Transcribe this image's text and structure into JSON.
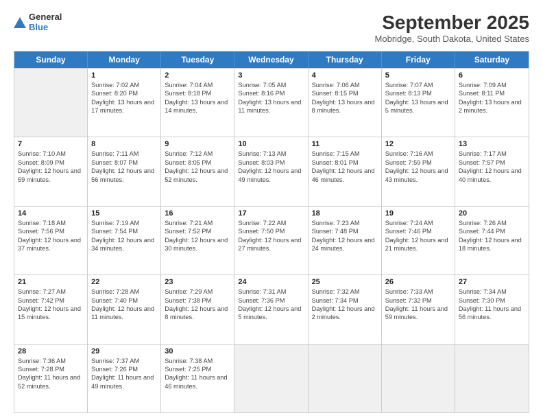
{
  "logo": {
    "general": "General",
    "blue": "Blue"
  },
  "title": "September 2025",
  "subtitle": "Mobridge, South Dakota, United States",
  "days": [
    "Sunday",
    "Monday",
    "Tuesday",
    "Wednesday",
    "Thursday",
    "Friday",
    "Saturday"
  ],
  "weeks": [
    [
      {
        "day": "",
        "sunrise": "",
        "sunset": "",
        "daylight": "",
        "shaded": true
      },
      {
        "day": "1",
        "sunrise": "Sunrise: 7:02 AM",
        "sunset": "Sunset: 8:20 PM",
        "daylight": "Daylight: 13 hours and 17 minutes."
      },
      {
        "day": "2",
        "sunrise": "Sunrise: 7:04 AM",
        "sunset": "Sunset: 8:18 PM",
        "daylight": "Daylight: 13 hours and 14 minutes."
      },
      {
        "day": "3",
        "sunrise": "Sunrise: 7:05 AM",
        "sunset": "Sunset: 8:16 PM",
        "daylight": "Daylight: 13 hours and 11 minutes."
      },
      {
        "day": "4",
        "sunrise": "Sunrise: 7:06 AM",
        "sunset": "Sunset: 8:15 PM",
        "daylight": "Daylight: 13 hours and 8 minutes."
      },
      {
        "day": "5",
        "sunrise": "Sunrise: 7:07 AM",
        "sunset": "Sunset: 8:13 PM",
        "daylight": "Daylight: 13 hours and 5 minutes."
      },
      {
        "day": "6",
        "sunrise": "Sunrise: 7:09 AM",
        "sunset": "Sunset: 8:11 PM",
        "daylight": "Daylight: 13 hours and 2 minutes."
      }
    ],
    [
      {
        "day": "7",
        "sunrise": "Sunrise: 7:10 AM",
        "sunset": "Sunset: 8:09 PM",
        "daylight": "Daylight: 12 hours and 59 minutes."
      },
      {
        "day": "8",
        "sunrise": "Sunrise: 7:11 AM",
        "sunset": "Sunset: 8:07 PM",
        "daylight": "Daylight: 12 hours and 56 minutes."
      },
      {
        "day": "9",
        "sunrise": "Sunrise: 7:12 AM",
        "sunset": "Sunset: 8:05 PM",
        "daylight": "Daylight: 12 hours and 52 minutes."
      },
      {
        "day": "10",
        "sunrise": "Sunrise: 7:13 AM",
        "sunset": "Sunset: 8:03 PM",
        "daylight": "Daylight: 12 hours and 49 minutes."
      },
      {
        "day": "11",
        "sunrise": "Sunrise: 7:15 AM",
        "sunset": "Sunset: 8:01 PM",
        "daylight": "Daylight: 12 hours and 46 minutes."
      },
      {
        "day": "12",
        "sunrise": "Sunrise: 7:16 AM",
        "sunset": "Sunset: 7:59 PM",
        "daylight": "Daylight: 12 hours and 43 minutes."
      },
      {
        "day": "13",
        "sunrise": "Sunrise: 7:17 AM",
        "sunset": "Sunset: 7:57 PM",
        "daylight": "Daylight: 12 hours and 40 minutes."
      }
    ],
    [
      {
        "day": "14",
        "sunrise": "Sunrise: 7:18 AM",
        "sunset": "Sunset: 7:56 PM",
        "daylight": "Daylight: 12 hours and 37 minutes."
      },
      {
        "day": "15",
        "sunrise": "Sunrise: 7:19 AM",
        "sunset": "Sunset: 7:54 PM",
        "daylight": "Daylight: 12 hours and 34 minutes."
      },
      {
        "day": "16",
        "sunrise": "Sunrise: 7:21 AM",
        "sunset": "Sunset: 7:52 PM",
        "daylight": "Daylight: 12 hours and 30 minutes."
      },
      {
        "day": "17",
        "sunrise": "Sunrise: 7:22 AM",
        "sunset": "Sunset: 7:50 PM",
        "daylight": "Daylight: 12 hours and 27 minutes."
      },
      {
        "day": "18",
        "sunrise": "Sunrise: 7:23 AM",
        "sunset": "Sunset: 7:48 PM",
        "daylight": "Daylight: 12 hours and 24 minutes."
      },
      {
        "day": "19",
        "sunrise": "Sunrise: 7:24 AM",
        "sunset": "Sunset: 7:46 PM",
        "daylight": "Daylight: 12 hours and 21 minutes."
      },
      {
        "day": "20",
        "sunrise": "Sunrise: 7:26 AM",
        "sunset": "Sunset: 7:44 PM",
        "daylight": "Daylight: 12 hours and 18 minutes."
      }
    ],
    [
      {
        "day": "21",
        "sunrise": "Sunrise: 7:27 AM",
        "sunset": "Sunset: 7:42 PM",
        "daylight": "Daylight: 12 hours and 15 minutes."
      },
      {
        "day": "22",
        "sunrise": "Sunrise: 7:28 AM",
        "sunset": "Sunset: 7:40 PM",
        "daylight": "Daylight: 12 hours and 11 minutes."
      },
      {
        "day": "23",
        "sunrise": "Sunrise: 7:29 AM",
        "sunset": "Sunset: 7:38 PM",
        "daylight": "Daylight: 12 hours and 8 minutes."
      },
      {
        "day": "24",
        "sunrise": "Sunrise: 7:31 AM",
        "sunset": "Sunset: 7:36 PM",
        "daylight": "Daylight: 12 hours and 5 minutes."
      },
      {
        "day": "25",
        "sunrise": "Sunrise: 7:32 AM",
        "sunset": "Sunset: 7:34 PM",
        "daylight": "Daylight: 12 hours and 2 minutes."
      },
      {
        "day": "26",
        "sunrise": "Sunrise: 7:33 AM",
        "sunset": "Sunset: 7:32 PM",
        "daylight": "Daylight: 11 hours and 59 minutes."
      },
      {
        "day": "27",
        "sunrise": "Sunrise: 7:34 AM",
        "sunset": "Sunset: 7:30 PM",
        "daylight": "Daylight: 11 hours and 56 minutes."
      }
    ],
    [
      {
        "day": "28",
        "sunrise": "Sunrise: 7:36 AM",
        "sunset": "Sunset: 7:28 PM",
        "daylight": "Daylight: 11 hours and 52 minutes."
      },
      {
        "day": "29",
        "sunrise": "Sunrise: 7:37 AM",
        "sunset": "Sunset: 7:26 PM",
        "daylight": "Daylight: 11 hours and 49 minutes."
      },
      {
        "day": "30",
        "sunrise": "Sunrise: 7:38 AM",
        "sunset": "Sunset: 7:25 PM",
        "daylight": "Daylight: 11 hours and 46 minutes."
      },
      {
        "day": "",
        "sunrise": "",
        "sunset": "",
        "daylight": "",
        "shaded": true
      },
      {
        "day": "",
        "sunrise": "",
        "sunset": "",
        "daylight": "",
        "shaded": true
      },
      {
        "day": "",
        "sunrise": "",
        "sunset": "",
        "daylight": "",
        "shaded": true
      },
      {
        "day": "",
        "sunrise": "",
        "sunset": "",
        "daylight": "",
        "shaded": true
      }
    ]
  ]
}
